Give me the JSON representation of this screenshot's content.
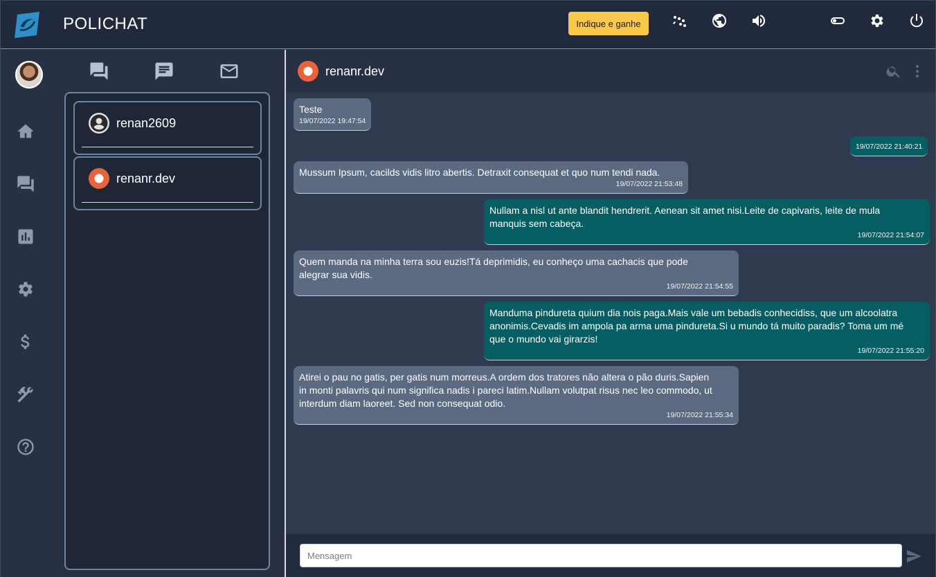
{
  "app": {
    "brand": "POLICHAT",
    "promo_label": "Indique e ganhe"
  },
  "topbar": {
    "icons": [
      "signal-icon",
      "globe-icon",
      "volume-icon",
      "moon-icon",
      "toggle-icon",
      "settings-icon",
      "power-icon"
    ]
  },
  "rail": {
    "items": [
      "home-icon",
      "chats-icon",
      "reports-icon",
      "settings-icon",
      "billing-icon",
      "tools-icon",
      "help-icon"
    ]
  },
  "contacts": {
    "tabs": [
      "conversations-icon",
      "message-icon",
      "mail-icon"
    ],
    "items": [
      {
        "name": "renan2609",
        "avatar": "default-avatar"
      },
      {
        "name": "renanr.dev",
        "avatar": "linux-avatar"
      }
    ]
  },
  "chat": {
    "contact_name": "renanr.dev",
    "messages": [
      {
        "direction": "in",
        "text": "Teste",
        "time": "19/07/2022 19:47:54"
      },
      {
        "direction": "out",
        "text": "",
        "time": "19/07/2022 21:40:21"
      },
      {
        "direction": "in",
        "text": "Mussum Ipsum, cacilds vidis litro abertis. Detraxit consequat et quo num tendi nada.",
        "time": "19/07/2022 21:53:48"
      },
      {
        "direction": "out",
        "text": "Nullam a nisl ut ante blandit hendrerit. Aenean sit amet nisi.Leite de capivaris, leite de mula manquis sem cabeça.",
        "time": "19/07/2022 21:54:07"
      },
      {
        "direction": "in",
        "text": "Quem manda na minha terra sou euzis!Tá deprimidis, eu conheço uma cachacis que pode alegrar sua vidis.",
        "time": "19/07/2022 21:54:55"
      },
      {
        "direction": "out",
        "text": "Manduma pindureta quium dia nois paga.Mais vale um bebadis conhecidiss, que um alcoolatra anonimis.Cevadis im ampola pa arma uma pindureta.Si u mundo tá muito paradis? Toma um mé que o mundo vai girarzis!",
        "time": "19/07/2022 21:55:20"
      },
      {
        "direction": "in",
        "text": "Atirei o pau no gatis, per gatis num morreus.A ordem dos tratores não altera o pão duris.Sapien in monti palavris qui num significa nadis i pareci latim.Nullam volutpat risus nec leo commodo, ut interdum diam laoreet. Sed non consequat odio.",
        "time": "19/07/2022 21:55:34"
      }
    ],
    "composer": {
      "placeholder": "Mensagem"
    }
  }
}
